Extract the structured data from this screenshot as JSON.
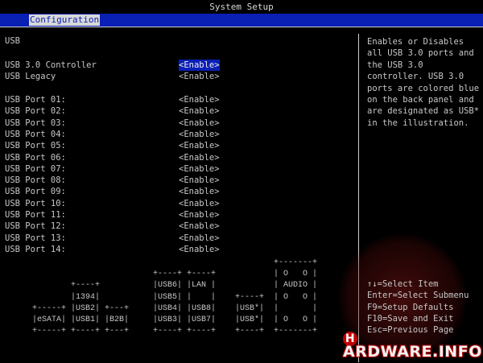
{
  "header": {
    "title": "System Setup",
    "active_tab": "Configuration"
  },
  "section": {
    "title": "USB"
  },
  "settings": {
    "controller": {
      "label": "USB 3.0 Controller",
      "value": "<Enable>"
    },
    "legacy": {
      "label": "USB Legacy",
      "value": "<Enable>"
    },
    "ports": [
      {
        "label": "USB Port 01:",
        "value": "<Enable>"
      },
      {
        "label": "USB Port 02:",
        "value": "<Enable>"
      },
      {
        "label": "USB Port 03:",
        "value": "<Enable>"
      },
      {
        "label": "USB Port 04:",
        "value": "<Enable>"
      },
      {
        "label": "USB Port 05:",
        "value": "<Enable>"
      },
      {
        "label": "USB Port 06:",
        "value": "<Enable>"
      },
      {
        "label": "USB Port 07:",
        "value": "<Enable>"
      },
      {
        "label": "USB Port 08:",
        "value": "<Enable>"
      },
      {
        "label": "USB Port 09:",
        "value": "<Enable>"
      },
      {
        "label": "USB Port 10:",
        "value": "<Enable>"
      },
      {
        "label": "USB Port 11:",
        "value": "<Enable>"
      },
      {
        "label": "USB Port 12:",
        "value": "<Enable>"
      },
      {
        "label": "USB Port 13:",
        "value": "<Enable>"
      },
      {
        "label": "USB Port 14:",
        "value": "<Enable>"
      }
    ]
  },
  "help": {
    "text": "Enables or Disables all USB 3.0 ports and the USB 3.0 controller. USB 3.0 ports are colored blue on the back panel and are designated as USB* in the illustration."
  },
  "panel_diagram": {
    "lines": [
      "                                                  +-------+",
      "                         +----+ +----+            | O   O |",
      "        +----+           |USB6| |LAN |            | AUDIO |",
      "        |1394|           |USB5| |    |    +----+  | O   O |",
      "+-----+ |USB2| +---+     |USB4| |USB8|    |USB*|  |       |",
      "|eSATA| |USB1| |B2B|     |USB3| |USB7|    |USB*|  | O   O |",
      "+-----+ +----+ +---+     +----+ +----+    +----+  +-------+"
    ]
  },
  "keys": [
    "↑↓=Select Item",
    "Enter=Select Submenu",
    "F9=Setup Defaults",
    "F10=Save and Exit",
    "Esc=Previous Page"
  ],
  "watermark": {
    "text": "ARDWARE.INFO",
    "mark": "H"
  },
  "colors": {
    "background": "#000000",
    "accent_blue": "#0a1fb4",
    "text": "#c8c8c8"
  }
}
